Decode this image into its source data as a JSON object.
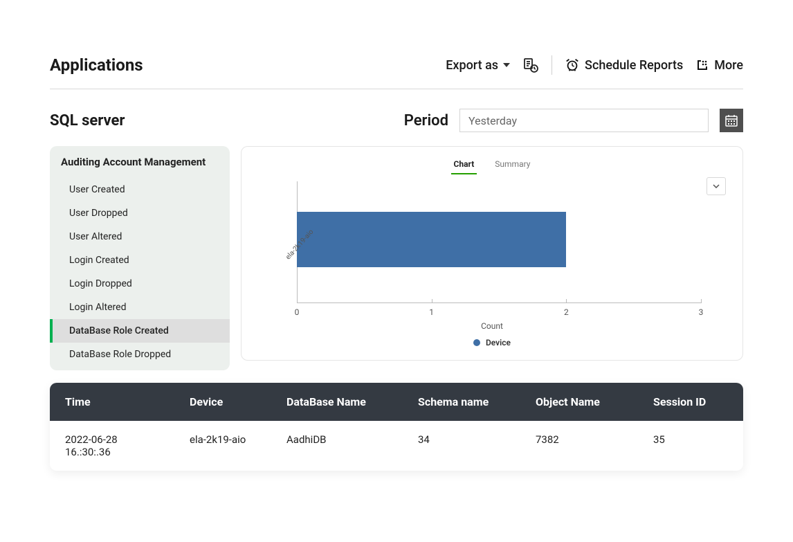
{
  "header": {
    "title": "Applications",
    "export_label": "Export as",
    "schedule_label": "Schedule Reports",
    "more_label": "More"
  },
  "subheader": {
    "subtitle": "SQL server",
    "period_label": "Period",
    "period_value": "Yesterday"
  },
  "sidebar": {
    "title": "Auditing Account Management",
    "items": [
      {
        "label": "User Created",
        "active": false
      },
      {
        "label": "User Dropped",
        "active": false
      },
      {
        "label": "User Altered",
        "active": false
      },
      {
        "label": "Login Created",
        "active": false
      },
      {
        "label": "Login Dropped",
        "active": false
      },
      {
        "label": "Login Altered",
        "active": false
      },
      {
        "label": "DataBase Role Created",
        "active": true
      },
      {
        "label": "DataBase Role Dropped",
        "active": false
      }
    ]
  },
  "chart_tabs": [
    {
      "label": "Chart",
      "active": true
    },
    {
      "label": "Summary",
      "active": false
    }
  ],
  "chart_data": {
    "type": "bar",
    "orientation": "horizontal",
    "categories": [
      "ela-2k19-aio"
    ],
    "values": [
      2
    ],
    "title": "",
    "xlabel": "Count",
    "ylabel": "",
    "xlim": [
      0,
      3
    ],
    "xticks": [
      0,
      1,
      2,
      3
    ],
    "legend": "Device",
    "bar_color": "#3f6fa6"
  },
  "table": {
    "columns": [
      "Time",
      "Device",
      "DataBase Name",
      "Schema name",
      "Object Name",
      "Session ID"
    ],
    "rows": [
      {
        "time": "2022-06-28 16.:30:.36",
        "device": "ela-2k19-aio",
        "db": "AadhiDB",
        "schema": "34",
        "object": "7382",
        "session": "35"
      }
    ]
  }
}
